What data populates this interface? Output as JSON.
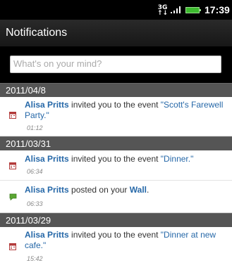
{
  "status_bar": {
    "network_top": "3G",
    "network_bottom": "↑↓",
    "time": "17:39"
  },
  "header": {
    "title": "Notifications"
  },
  "composer": {
    "placeholder": "What's on your mind?"
  },
  "sections": [
    {
      "date": "2011/04/8",
      "items": [
        {
          "icon": "calendar-icon",
          "name": "Alisa Pritts",
          "action": " invited you to the event ",
          "target": "\"Scott's Farewell Party.\"",
          "time": "01:12"
        }
      ]
    },
    {
      "date": "2011/03/31",
      "items": [
        {
          "icon": "calendar-icon",
          "name": "Alisa Pritts",
          "action": " invited you to the event ",
          "target": "\"Dinner.\"",
          "time": "06:34"
        },
        {
          "icon": "wall-post-icon",
          "name": "Alisa Pritts",
          "action": " posted on your ",
          "target": "Wall",
          "suffix": ".",
          "time": "06:33"
        }
      ]
    },
    {
      "date": "2011/03/29",
      "items": [
        {
          "icon": "calendar-icon",
          "name": "Alisa Pritts",
          "action": " invited you to the event ",
          "target": "\"Dinner at new cafe.\"",
          "time": "15:42"
        }
      ]
    }
  ],
  "colors": {
    "name_link": "#2668a8",
    "section_header_bg": "#555555",
    "title_bar_bg": "#1f1f1f",
    "calendar_icon": "#b23a3a",
    "wall_icon": "#5aa632"
  }
}
